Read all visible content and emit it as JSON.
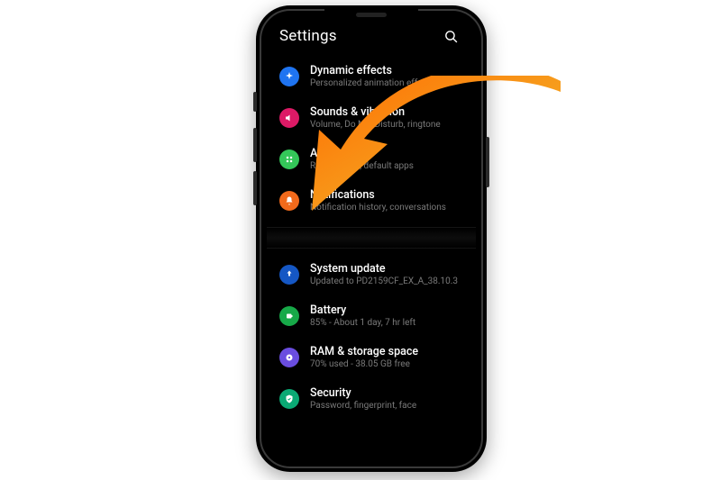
{
  "header": {
    "title": "Settings",
    "search_label": "Search"
  },
  "items": {
    "dynamic_effects": {
      "title": "Dynamic effects",
      "sub": "Personalized animation effects"
    },
    "sounds_vibration": {
      "title": "Sounds & vibration",
      "sub": "Volume, Do Not Disturb, ringtone"
    },
    "apps": {
      "title": "Apps",
      "sub": "Recent apps, default apps"
    },
    "notifications": {
      "title": "Notifications",
      "sub": "Notification history, conversations"
    },
    "system_update": {
      "title": "System update",
      "sub": "Updated to PD2159CF_EX_A_38.10.3"
    },
    "battery": {
      "title": "Battery",
      "sub": "85% - About 1 day, 7 hr left"
    },
    "ram_storage": {
      "title": "RAM & storage space",
      "sub": "70% used - 38.05 GB free"
    },
    "security": {
      "title": "Security",
      "sub": "Password, fingerprint, face"
    }
  }
}
